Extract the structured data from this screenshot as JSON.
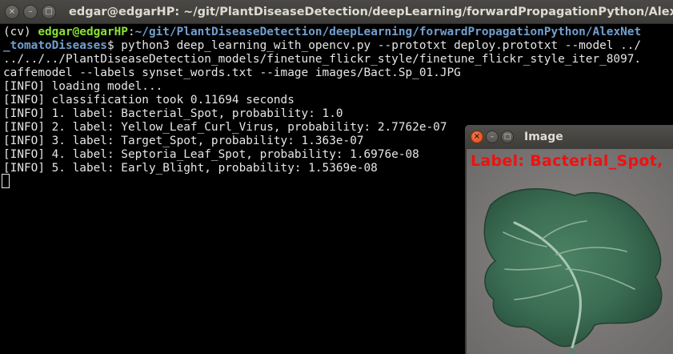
{
  "terminal": {
    "title": "edgar@edgarHP: ~/git/PlantDiseaseDetection/deepLearning/forwardPropagationPython/AlexNet_tomatoDiseases",
    "buttons": {
      "close": "×",
      "minimize": "–",
      "maximize": "□"
    },
    "prompt": {
      "env": "(cv) ",
      "user": "edgar@edgarHP",
      "sep": ":",
      "path_part1": "~/git/PlantDiseaseDetection/deepLearning/forwardPropagationPython/AlexNet",
      "path_part2": "_tomatoDiseases",
      "symbol": "$ "
    },
    "command_part1": "python3 deep_learning_with_opencv.py --prototxt deploy.prototxt --model ../",
    "command_part2": "../../../PlantDiseaseDetection_models/finetune_flickr_style/finetune_flickr_style_iter_8097.",
    "command_part3": "caffemodel --labels synset_words.txt --image images/Bact.Sp_01.JPG",
    "output": [
      "[INFO] loading model...",
      "[INFO] classification took 0.11694 seconds",
      "[INFO] 1. label: Bacterial_Spot, probability: 1.0",
      "[INFO] 2. label: Yellow_Leaf_Curl_Virus, probability: 2.7762e-07",
      "[INFO] 3. label: Target_Spot, probability: 1.363e-07",
      "[INFO] 4. label: Septoria_Leaf_Spot, probability: 1.6976e-08",
      "[INFO] 5. label: Early_Blight, probability: 1.5369e-08"
    ]
  },
  "image_window": {
    "title": "Image",
    "buttons": {
      "close": "×",
      "minimize": "–",
      "maximize": "□"
    },
    "label": "Label: Bacterial_Spot,",
    "label_color": "#ee1111",
    "image": "tomato-leaf-photo"
  },
  "colors": {
    "prompt_user": "#8ae234",
    "prompt_path": "#729fcf",
    "terminal_bg": "#000000",
    "close_button": "#e95420"
  }
}
